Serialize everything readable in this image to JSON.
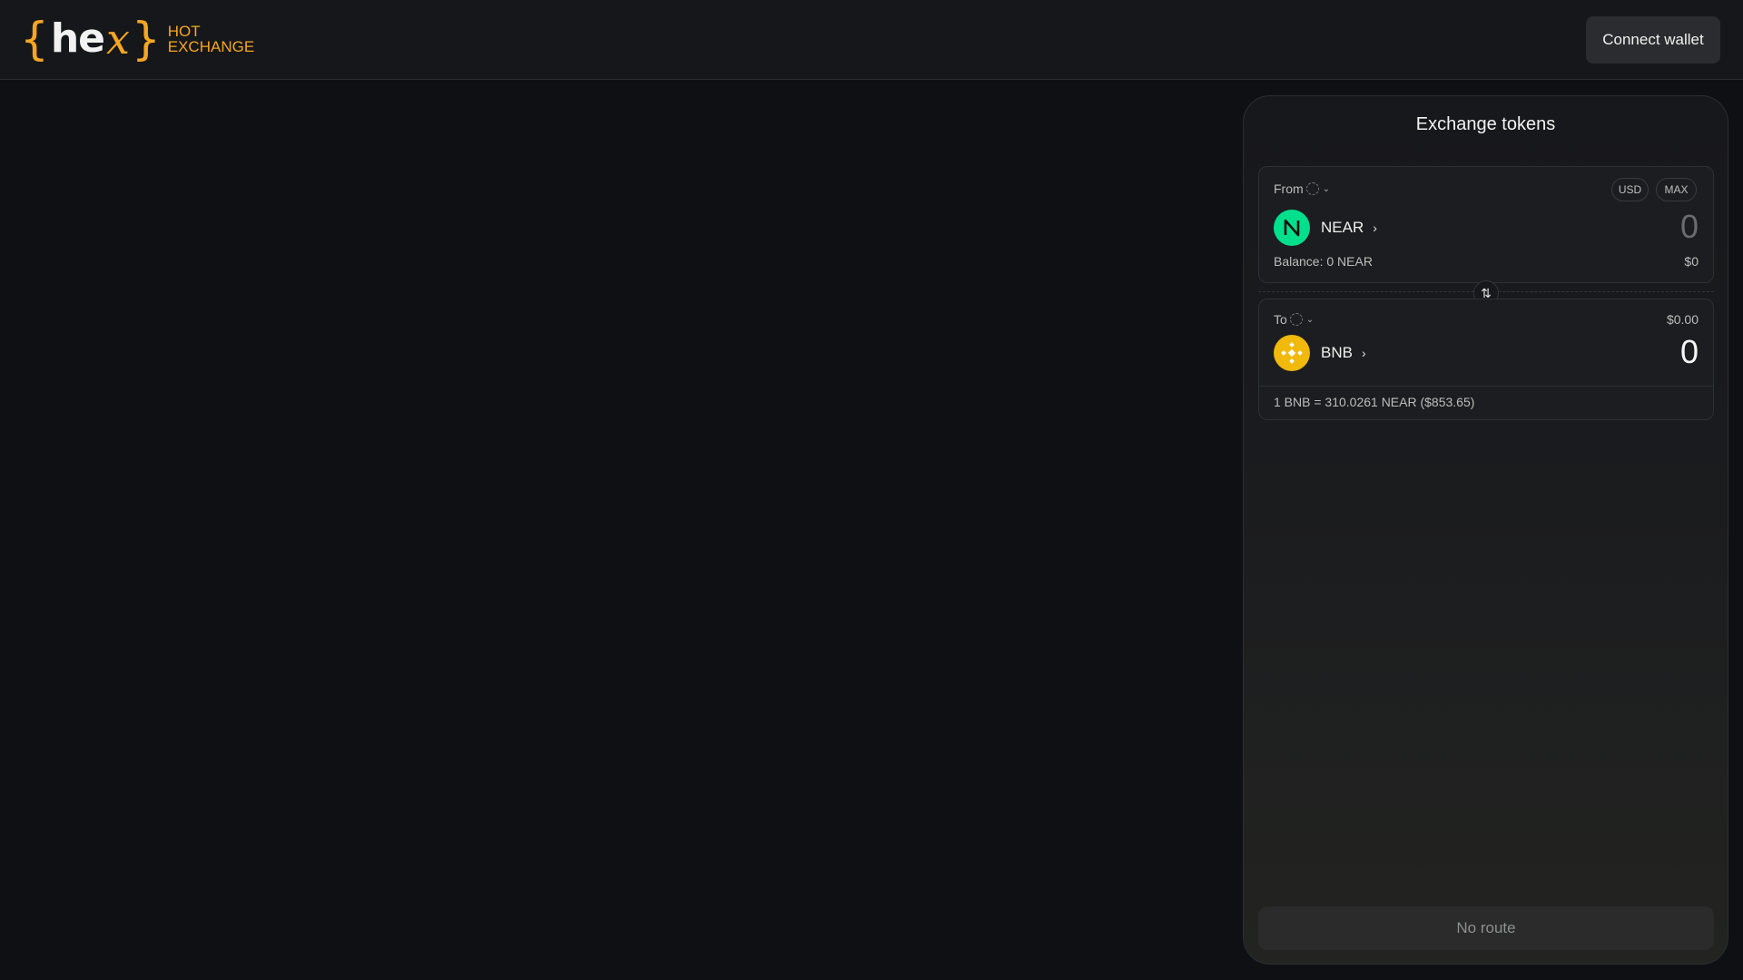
{
  "header": {
    "logo": {
      "brace_open": "{",
      "he": "he",
      "x": "x",
      "brace_close": "}",
      "line1": "HOT",
      "line2": "EXCHANGE"
    },
    "connect_label": "Connect wallet"
  },
  "exchange": {
    "title": "Exchange tokens",
    "from": {
      "label": "From",
      "usd_label": "USD",
      "max_label": "MAX",
      "token": "NEAR",
      "token_icon": "near-logo",
      "amount": "0",
      "balance": "Balance: 0 NEAR",
      "usd_value": "$0"
    },
    "to": {
      "label": "To",
      "usd_value": "$0.00",
      "token": "BNB",
      "token_icon": "bnb-logo",
      "amount": "0",
      "rate": "1 BNB = 310.0261 NEAR ($853.65)"
    },
    "action_label": "No route"
  },
  "colors": {
    "accent": "#f5a623",
    "near": "#00e08c",
    "bnb": "#f0b90b"
  }
}
